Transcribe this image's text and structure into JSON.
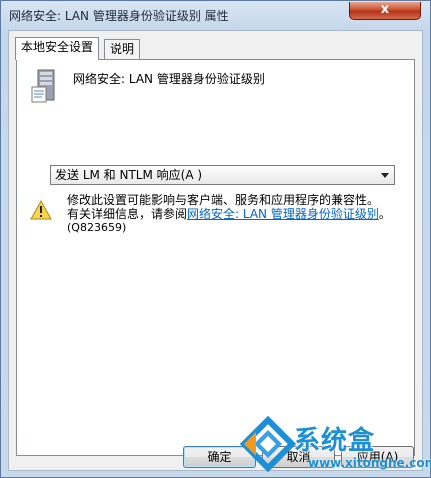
{
  "window": {
    "title": "网络安全: LAN 管理器身份验证级别 属性",
    "close_glyph": "x"
  },
  "tabs": [
    {
      "label": "本地安全设置",
      "active": true
    },
    {
      "label": "说明",
      "active": false
    }
  ],
  "policy": {
    "icon": "server-policy-icon",
    "title": "网络安全: LAN 管理器身份验证级别"
  },
  "select": {
    "value": "发送 LM 和 NTLM 响应(A )"
  },
  "warning": {
    "icon": "warning-icon",
    "line1": "修改此设置可能影响与客户端、服务和应用程序的兼容性。",
    "line2_prefix": "有关详细信息，请参阅",
    "link": "网络安全: LAN 管理器身份验证级别",
    "line2_suffix": "。",
    "kb": "(Q823659)"
  },
  "buttons": {
    "ok": "确定",
    "cancel": "取消",
    "apply": "应用(A)"
  },
  "watermark": {
    "brand": "系统盒",
    "url": "www.xitonghe.com"
  }
}
